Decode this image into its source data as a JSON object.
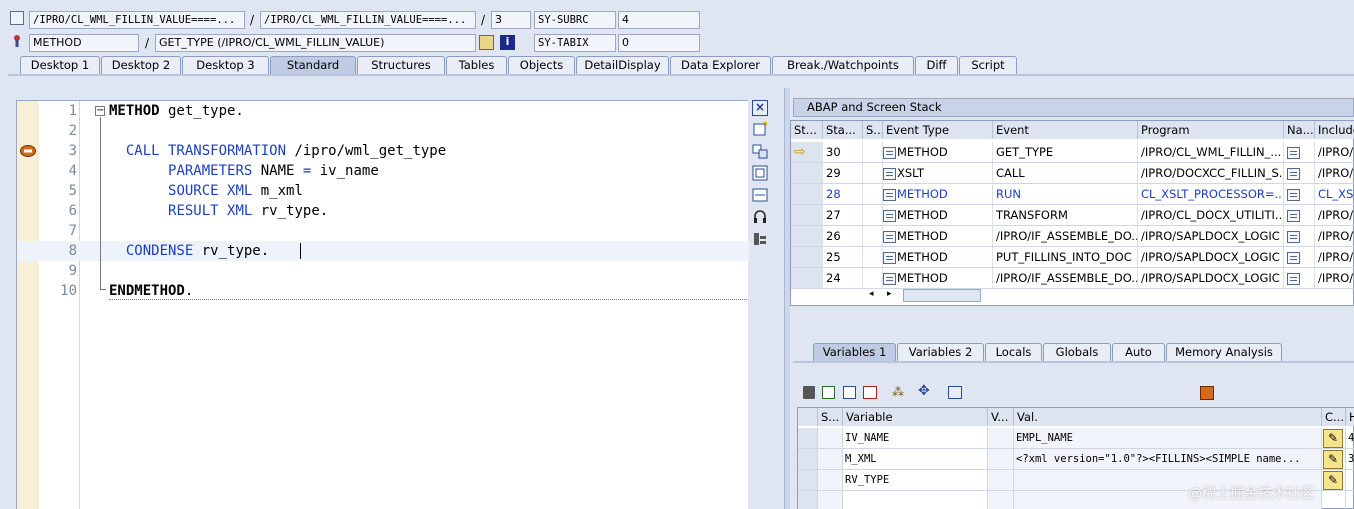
{
  "header": {
    "row1": {
      "field1": "/IPRO/CL_WML_FILLIN_VALUE====...",
      "field2": "/IPRO/CL_WML_FILLIN_VALUE====...",
      "sep": "/",
      "line": "3",
      "sysvar": "SY-SUBRC",
      "sysval": "4"
    },
    "row2": {
      "type": "METHOD",
      "sep": "/",
      "name": "GET_TYPE (/IPRO/CL_WML_FILLIN_VALUE)",
      "sysvar": "SY-TABIX",
      "sysval": "0"
    }
  },
  "tabs": [
    "Desktop 1",
    "Desktop 2",
    "Desktop 3",
    "Standard",
    "Structures",
    "Tables",
    "Objects",
    "DetailDisplay",
    "Data Explorer",
    "Break./Watchpoints",
    "Diff",
    "Script"
  ],
  "active_tab": "Standard",
  "editor": {
    "lines": [
      {
        "n": "1",
        "parts": [
          [
            "kwb",
            "METHOD"
          ],
          [
            "plain",
            " get_type."
          ]
        ]
      },
      {
        "n": "2",
        "parts": []
      },
      {
        "n": "3",
        "parts": [
          [
            "plain",
            "  "
          ],
          [
            "kw",
            "CALL TRANSFORMATION"
          ],
          [
            "plain",
            " /ipro/wml_get_type"
          ]
        ]
      },
      {
        "n": "4",
        "parts": [
          [
            "plain",
            "       "
          ],
          [
            "kw",
            "PARAMETERS"
          ],
          [
            "plain",
            " NAME "
          ],
          [
            "kw",
            "="
          ],
          [
            "plain",
            " iv_name"
          ]
        ]
      },
      {
        "n": "5",
        "parts": [
          [
            "plain",
            "       "
          ],
          [
            "kw",
            "SOURCE XML"
          ],
          [
            "plain",
            " m_xml"
          ]
        ]
      },
      {
        "n": "6",
        "parts": [
          [
            "plain",
            "       "
          ],
          [
            "kw",
            "RESULT XML"
          ],
          [
            "plain",
            " rv_type."
          ]
        ]
      },
      {
        "n": "7",
        "parts": []
      },
      {
        "n": "8",
        "parts": [
          [
            "plain",
            "  "
          ],
          [
            "kw",
            "CONDENSE"
          ],
          [
            "plain",
            " rv_type."
          ]
        ]
      },
      {
        "n": "9",
        "parts": []
      },
      {
        "n": "10",
        "parts": [
          [
            "kwb",
            "ENDMETHOD"
          ],
          [
            "plain",
            "."
          ]
        ]
      }
    ]
  },
  "stack": {
    "title": "ABAP and Screen Stack",
    "columns": [
      "St...",
      "Sta...",
      "S...",
      "Event Type",
      "Event",
      "Program",
      "Na...",
      "Include"
    ],
    "rows": [
      {
        "st": "⇨",
        "level": "30",
        "type": "METHOD",
        "event": "GET_TYPE",
        "program": "/IPRO/CL_WML_FILLIN_...",
        "include": "/IPRO/",
        "hl": false
      },
      {
        "st": "",
        "level": "29",
        "type": "XSLT",
        "event": "CALL",
        "program": "/IPRO/DOCXCC_FILLIN_S...",
        "include": "/IPRO/",
        "hl": false
      },
      {
        "st": "",
        "level": "28",
        "type": "METHOD",
        "event": "RUN",
        "program": "CL_XSLT_PROCESSOR=...",
        "include": "CL_XS",
        "hl": true
      },
      {
        "st": "",
        "level": "27",
        "type": "METHOD",
        "event": "TRANSFORM",
        "program": "/IPRO/CL_DOCX_UTILITI...",
        "include": "/IPRO/",
        "hl": false
      },
      {
        "st": "",
        "level": "26",
        "type": "METHOD",
        "event": "/IPRO/IF_ASSEMBLE_DO...",
        "program": "/IPRO/SAPLDOCX_LOGIC",
        "include": "/IPRO/",
        "hl": false
      },
      {
        "st": "",
        "level": "25",
        "type": "METHOD",
        "event": "PUT_FILLINS_INTO_DOC",
        "program": "/IPRO/SAPLDOCX_LOGIC",
        "include": "/IPRO/",
        "hl": false
      },
      {
        "st": "",
        "level": "24",
        "type": "METHOD",
        "event": "/IPRO/IF_ASSEMBLE_DO...",
        "program": "/IPRO/SAPLDOCX_LOGIC",
        "include": "/IPRO/",
        "hl": false
      }
    ]
  },
  "vartabs": [
    "Variables 1",
    "Variables 2",
    "Locals",
    "Globals",
    "Auto",
    "Memory Analysis"
  ],
  "active_vartab": "Variables 1",
  "variables": {
    "columns": [
      "S...",
      "Variable",
      "V...",
      "Val.",
      "C...",
      "H"
    ],
    "rows": [
      {
        "name": "IV_NAME",
        "value": "EMPL_NAME",
        "h": "4"
      },
      {
        "name": "M_XML",
        "value": "<?xml version=\"1.0\"?><FILLINS><SIMPLE name...",
        "h": "3"
      },
      {
        "name": "RV_TYPE",
        "value": "",
        "h": ""
      }
    ]
  },
  "watermark": "@稀土掘金技术社区"
}
